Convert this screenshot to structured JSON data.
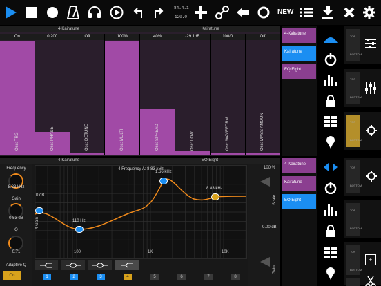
{
  "toolbar": {
    "tempo_top": "84.4.1",
    "tempo_bottom": "120.0",
    "new_label": "NEW",
    "accent": "#1b8ef2"
  },
  "upper": {
    "left_title": "4-Kairatune",
    "right_title": "Kairatune",
    "macros": [
      {
        "label": "Osc: TRG",
        "value": "On",
        "level": 1.0
      },
      {
        "label": "Osc: PHASE",
        "value": "0.200",
        "level": 0.2
      },
      {
        "label": "Osc: DETUNE",
        "value": "Off",
        "level": 0.0
      },
      {
        "label": "Osc: MULTI",
        "value": "100%",
        "level": 1.0
      },
      {
        "label": "Osc: SPREAD",
        "value": "40%",
        "level": 0.4
      },
      {
        "label": "Osc: LOW",
        "value": "-29.1dB",
        "level": 0.03
      },
      {
        "label": "Osc: WAVEFORM",
        "value": "100/0",
        "level": 0.0
      },
      {
        "label": "Osc: MASS AMOUN",
        "value": "Off",
        "level": 0.0
      }
    ]
  },
  "devices_upper": [
    {
      "label": "4-Kairatune",
      "style": "purple"
    },
    {
      "label": "Kairatune",
      "style": "sel"
    },
    {
      "label": "EQ Eight",
      "style": "purple"
    }
  ],
  "devices_lower": [
    {
      "label": "4-Kairatune",
      "style": "purple"
    },
    {
      "label": "Kairatune",
      "style": "purple"
    },
    {
      "label": "EQ Eight",
      "style": "sel"
    }
  ],
  "tracks": [
    {
      "tags": [
        "TOP",
        "BOTTOM"
      ]
    },
    {
      "tags": [
        "TOP",
        "BOTTOM"
      ]
    },
    {
      "tags": [
        "TOP",
        "BOTTOM"
      ]
    },
    {
      "tags": [
        "TOP",
        "BOTTOM"
      ]
    },
    {
      "tags": [
        "TOP",
        "BOTTOM"
      ]
    },
    {
      "tags": [
        "TOP",
        "BOTTOM"
      ]
    },
    {
      "tags": [
        "TOP",
        "BOTTOM"
      ]
    }
  ],
  "eq": {
    "left_title": "4-Kairatune",
    "right_title": "EQ Eight",
    "readout": "4 Frequency A: 8.83 kHz",
    "frequency_label": "Frequency",
    "frequency_value": "8.83 kHz",
    "gain_label": "Gain",
    "gain_value": "0.53 dB",
    "q_label": "Q",
    "q_value": "0.71",
    "adaptive_label": "Adaptive Q",
    "adaptive_value": "On",
    "axis_ticks": [
      "100",
      "1K",
      "10K"
    ],
    "gain_tick": "0 dB",
    "gain_side_label": "4 Gain",
    "band_points": [
      {
        "label": "",
        "num": "1",
        "color": "#1b8ef2"
      },
      {
        "label": "110 Hz",
        "num": "2",
        "color": "#1b8ef2"
      },
      {
        "label": "1.66 kHz",
        "num": "3",
        "color": "#1b8ef2"
      },
      {
        "label": "8.83 kHz",
        "num": "4",
        "color": "#d8a21c"
      }
    ],
    "band_numbers": [
      "1",
      "2",
      "3",
      "4",
      "5",
      "6",
      "7",
      "8"
    ],
    "scale_value": "100 %",
    "scale_label": "Scale",
    "out_gain_value": "0.00 dB",
    "out_gain_label": "Gain"
  }
}
